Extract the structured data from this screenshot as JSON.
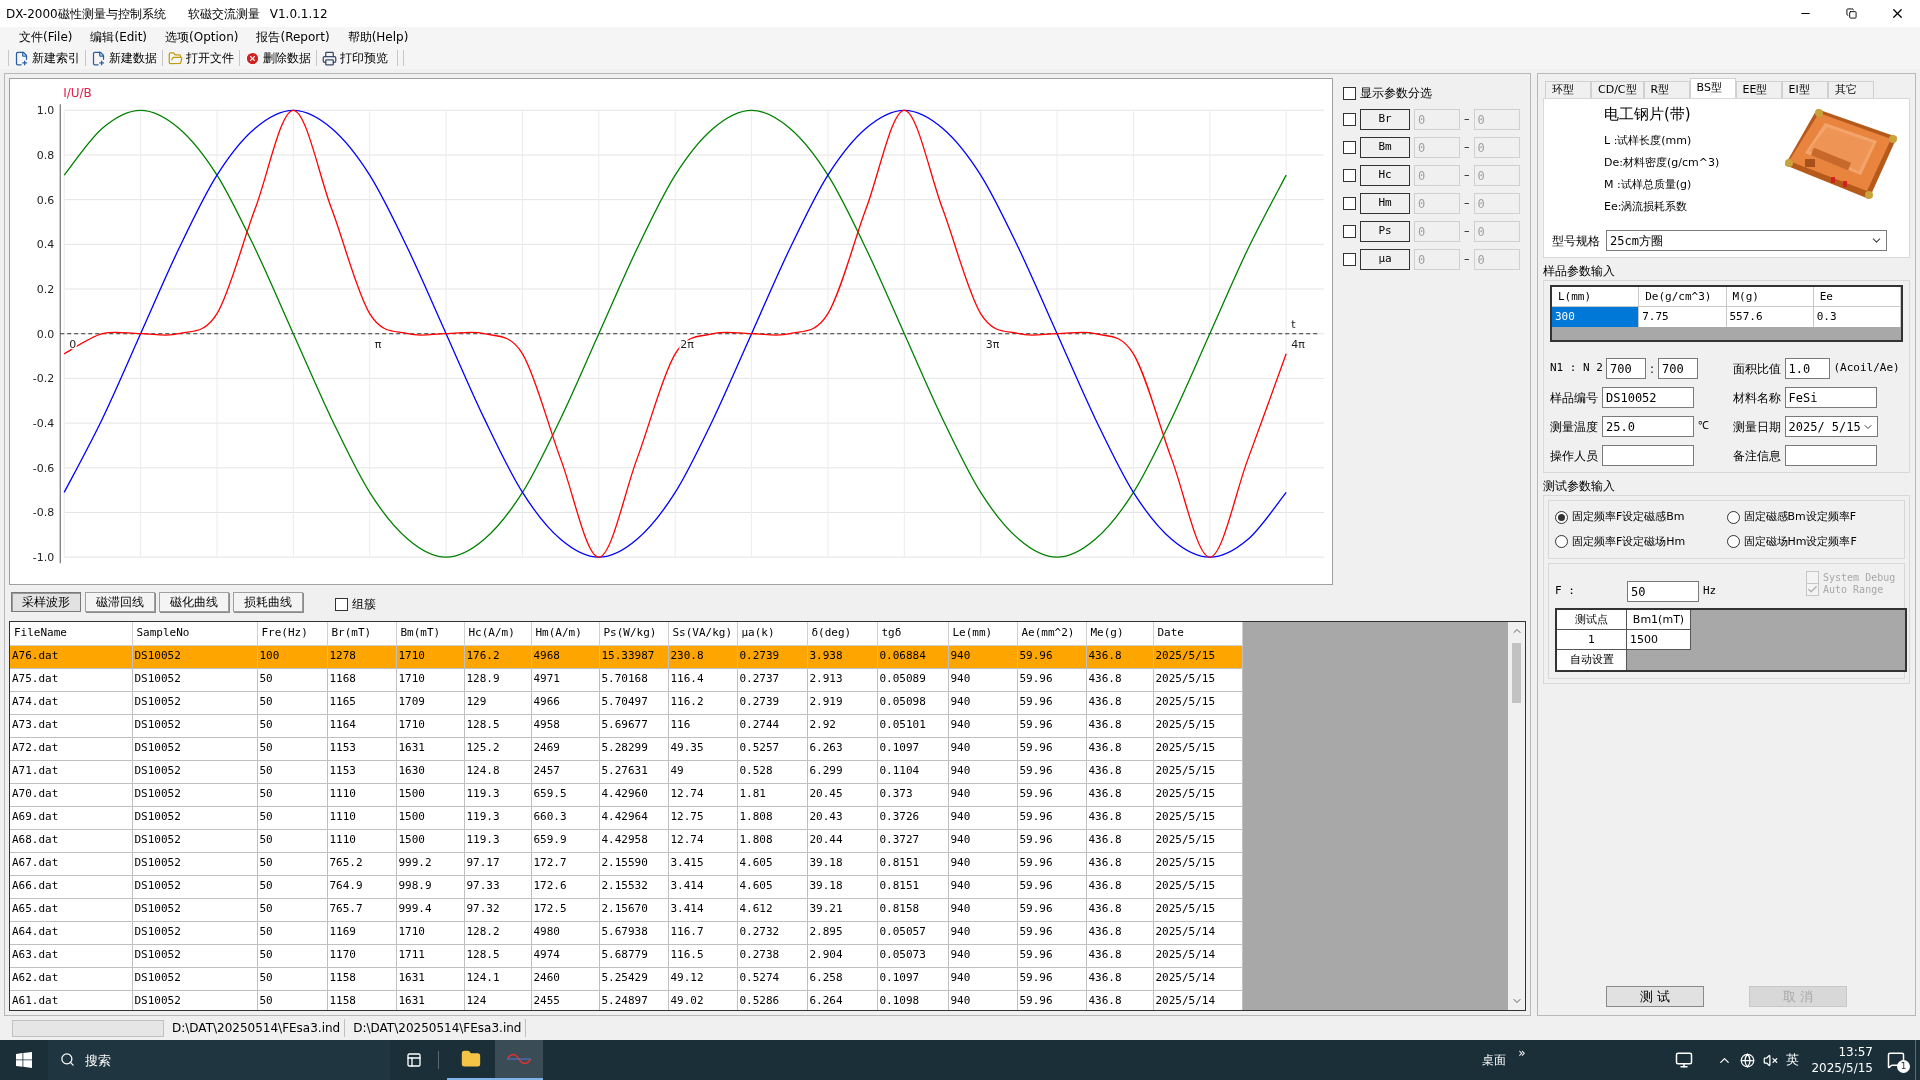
{
  "window": {
    "title": "DX-2000磁性测量与控制系统",
    "subtitle": "软磁交流测量",
    "version": "V1.0.1.12"
  },
  "menu": [
    "文件(File)",
    "编辑(Edit)",
    "选项(Option)",
    "报告(Report)",
    "帮助(Help)"
  ],
  "toolbar": [
    {
      "label": "新建索引",
      "kind": "new"
    },
    {
      "label": "新建数据",
      "kind": "new"
    },
    {
      "label": "打开文件",
      "kind": "open"
    },
    {
      "label": "删除数据",
      "kind": "delete"
    },
    {
      "label": "打印预览",
      "kind": "print"
    }
  ],
  "chart": {
    "chart_data": {
      "type": "line",
      "ylabel": "I/U/B",
      "xlabel": "t",
      "ylim": [
        -1.12,
        1.14
      ],
      "grid": true,
      "ref_lines": [
        {
          "axis": "y",
          "value": 0
        }
      ],
      "categories": [
        "0",
        null,
        null,
        null,
        null,
        null,
        null,
        null,
        "π",
        null,
        null,
        null,
        null,
        null,
        null,
        null,
        "2π",
        null,
        null,
        null,
        null,
        null,
        null,
        null,
        "3π",
        null,
        null,
        null,
        null,
        null,
        null,
        null,
        "4π"
      ],
      "yticks": [
        {
          "value": 1,
          "label": "1.0"
        },
        {
          "value": 0.8,
          "label": "0.8"
        },
        {
          "value": 0.6,
          "label": "0.6"
        },
        {
          "value": 0.4,
          "label": "0.4"
        },
        {
          "value": 0.2,
          "label": "0.2"
        },
        {
          "value": 0,
          "label": "0.0"
        },
        {
          "value": -0.2,
          "label": "-0.2"
        },
        {
          "value": -0.4,
          "label": "-0.4"
        },
        {
          "value": -0.6,
          "label": "-0.6"
        },
        {
          "value": -0.8,
          "label": "-0.8"
        },
        {
          "value": -1,
          "label": "-1.0"
        }
      ],
      "series": [
        {
          "color": "#008000",
          "values": [
            0.71,
            0.92,
            1,
            0.92,
            0.71,
            0.38,
            0,
            -0.38,
            -0.71,
            -0.92,
            -1,
            -0.92,
            -0.71,
            -0.38,
            0,
            0.38,
            0.71,
            0.92,
            1,
            0.92,
            0.71,
            0.38,
            0,
            -0.38,
            -0.71,
            -0.92,
            -1,
            -0.92,
            -0.71,
            -0.38,
            0,
            0.38,
            0.71
          ]
        },
        {
          "color": "#0000ff",
          "values": [
            -0.71,
            -0.38,
            0,
            0.38,
            0.71,
            0.92,
            1,
            0.92,
            0.71,
            0.38,
            0,
            -0.38,
            -0.71,
            -0.92,
            -1,
            -0.92,
            -0.71,
            -0.38,
            0,
            0.38,
            0.71,
            0.92,
            1,
            0.92,
            0.71,
            0.38,
            0,
            -0.38,
            -0.71,
            -0.92,
            -1,
            -0.92,
            -0.71
          ]
        },
        {
          "color": "#ff0000",
          "values": [
            -0.09,
            0,
            0,
            0,
            0.09,
            0.56,
            1,
            0.56,
            0.09,
            0,
            0,
            0,
            -0.09,
            -0.56,
            -1,
            -0.56,
            -0.09,
            0,
            0,
            0,
            0.09,
            0.56,
            1,
            0.56,
            0.09,
            0,
            0,
            0,
            -0.09,
            -0.56,
            -1,
            -0.56,
            -0.09
          ]
        }
      ]
    }
  },
  "filter": {
    "show": {
      "label": "显示参数分选",
      "checked": false
    },
    "rows": [
      {
        "label": "Br",
        "checked": false,
        "min": "0",
        "separator": "–",
        "max": "0",
        "disabled": true
      },
      {
        "label": "Bm",
        "checked": false,
        "min": "0",
        "separator": "–",
        "max": "0",
        "disabled": true
      },
      {
        "label": "Hc",
        "checked": false,
        "min": "0",
        "separator": "–",
        "max": "0",
        "disabled": true
      },
      {
        "label": "Hm",
        "checked": false,
        "min": "0",
        "separator": "–",
        "max": "0",
        "disabled": true
      },
      {
        "label": "Ps",
        "checked": false,
        "min": "0",
        "separator": "–",
        "max": "0",
        "disabled": true
      },
      {
        "label": "μa",
        "checked": false,
        "min": "0",
        "separator": "–",
        "max": "0",
        "disabled": true
      }
    ]
  },
  "view_tabs": [
    {
      "label": "采样波形",
      "selected": true
    },
    {
      "label": "磁滞回线",
      "selected": false
    },
    {
      "label": "磁化曲线",
      "selected": false
    },
    {
      "label": "损耗曲线",
      "selected": false
    }
  ],
  "cluster": {
    "label": "组簇",
    "checked": false
  },
  "table": {
    "columns": [
      "FileName",
      "SampleNo",
      "Fre(Hz)",
      "Br(mT)",
      "Bm(mT)",
      "Hc(A/m)",
      "Hm(A/m)",
      "Ps(W/kg)",
      "Ss(VA/kg)",
      "μa(k)",
      "δ(deg)",
      "tgδ",
      "Le(mm)",
      "Ae(mm^2)",
      "Me(g)",
      "Date"
    ],
    "rows": [
      {
        "selected": true,
        "cells": [
          "A76.dat",
          "DS10052",
          "100",
          "1278",
          "1710",
          "176.2",
          "4968",
          "15.33987",
          "230.8",
          "0.2739",
          "3.938",
          "0.06884",
          "940",
          "59.96",
          "436.8",
          "2025/5/15"
        ]
      },
      {
        "selected": false,
        "cells": [
          "A75.dat",
          "DS10052",
          "50",
          "1168",
          "1710",
          "128.9",
          "4971",
          "5.70168",
          "116.4",
          "0.2737",
          "2.913",
          "0.05089",
          "940",
          "59.96",
          "436.8",
          "2025/5/15"
        ]
      },
      {
        "selected": false,
        "cells": [
          "A74.dat",
          "DS10052",
          "50",
          "1165",
          "1709",
          "129",
          "4966",
          "5.70497",
          "116.2",
          "0.2739",
          "2.919",
          "0.05098",
          "940",
          "59.96",
          "436.8",
          "2025/5/15"
        ]
      },
      {
        "selected": false,
        "cells": [
          "A73.dat",
          "DS10052",
          "50",
          "1164",
          "1710",
          "128.5",
          "4958",
          "5.69677",
          "116",
          "0.2744",
          "2.92",
          "0.05101",
          "940",
          "59.96",
          "436.8",
          "2025/5/15"
        ]
      },
      {
        "selected": false,
        "cells": [
          "A72.dat",
          "DS10052",
          "50",
          "1153",
          "1631",
          "125.2",
          "2469",
          "5.28299",
          "49.35",
          "0.5257",
          "6.263",
          "0.1097",
          "940",
          "59.96",
          "436.8",
          "2025/5/15"
        ]
      },
      {
        "selected": false,
        "cells": [
          "A71.dat",
          "DS10052",
          "50",
          "1153",
          "1630",
          "124.8",
          "2457",
          "5.27631",
          "49",
          "0.528",
          "6.299",
          "0.1104",
          "940",
          "59.96",
          "436.8",
          "2025/5/15"
        ]
      },
      {
        "selected": false,
        "cells": [
          "A70.dat",
          "DS10052",
          "50",
          "1110",
          "1500",
          "119.3",
          "659.5",
          "4.42960",
          "12.74",
          "1.81",
          "20.45",
          "0.373",
          "940",
          "59.96",
          "436.8",
          "2025/5/15"
        ]
      },
      {
        "selected": false,
        "cells": [
          "A69.dat",
          "DS10052",
          "50",
          "1110",
          "1500",
          "119.3",
          "660.3",
          "4.42964",
          "12.75",
          "1.808",
          "20.43",
          "0.3726",
          "940",
          "59.96",
          "436.8",
          "2025/5/15"
        ]
      },
      {
        "selected": false,
        "cells": [
          "A68.dat",
          "DS10052",
          "50",
          "1110",
          "1500",
          "119.3",
          "659.9",
          "4.42958",
          "12.74",
          "1.808",
          "20.44",
          "0.3727",
          "940",
          "59.96",
          "436.8",
          "2025/5/15"
        ]
      },
      {
        "selected": false,
        "cells": [
          "A67.dat",
          "DS10052",
          "50",
          "765.2",
          "999.2",
          "97.17",
          "172.7",
          "2.15590",
          "3.415",
          "4.605",
          "39.18",
          "0.8151",
          "940",
          "59.96",
          "436.8",
          "2025/5/15"
        ]
      },
      {
        "selected": false,
        "cells": [
          "A66.dat",
          "DS10052",
          "50",
          "764.9",
          "998.9",
          "97.33",
          "172.6",
          "2.15532",
          "3.414",
          "4.605",
          "39.18",
          "0.8151",
          "940",
          "59.96",
          "436.8",
          "2025/5/15"
        ]
      },
      {
        "selected": false,
        "cells": [
          "A65.dat",
          "DS10052",
          "50",
          "765.7",
          "999.4",
          "97.32",
          "172.5",
          "2.15670",
          "3.414",
          "4.612",
          "39.21",
          "0.8158",
          "940",
          "59.96",
          "436.8",
          "2025/5/15"
        ]
      },
      {
        "selected": false,
        "cells": [
          "A64.dat",
          "DS10052",
          "50",
          "1169",
          "1710",
          "128.2",
          "4980",
          "5.67938",
          "116.7",
          "0.2732",
          "2.895",
          "0.05057",
          "940",
          "59.96",
          "436.8",
          "2025/5/14"
        ]
      },
      {
        "selected": false,
        "cells": [
          "A63.dat",
          "DS10052",
          "50",
          "1170",
          "1711",
          "128.5",
          "4974",
          "5.68779",
          "116.5",
          "0.2738",
          "2.904",
          "0.05073",
          "940",
          "59.96",
          "436.8",
          "2025/5/14"
        ]
      },
      {
        "selected": false,
        "cells": [
          "A62.dat",
          "DS10052",
          "50",
          "1158",
          "1631",
          "124.1",
          "2460",
          "5.25429",
          "49.12",
          "0.5274",
          "6.258",
          "0.1097",
          "940",
          "59.96",
          "436.8",
          "2025/5/14"
        ]
      },
      {
        "selected": false,
        "cells": [
          "A61.dat",
          "DS10052",
          "50",
          "1158",
          "1631",
          "124",
          "2455",
          "5.24897",
          "49.02",
          "0.5286",
          "6.264",
          "0.1098",
          "940",
          "59.96",
          "436.8",
          "2025/5/14"
        ]
      }
    ]
  },
  "status_bar": {
    "paths": [
      "D:\\DAT\\20250514\\FEsa3.ind",
      "D:\\DAT\\20250514\\FEsa3.ind"
    ]
  },
  "type_tabs": [
    {
      "label": "环型",
      "selected": false
    },
    {
      "label": "CD/C型",
      "selected": false
    },
    {
      "label": "R型",
      "selected": false
    },
    {
      "label": "BS型",
      "selected": true
    },
    {
      "label": "EE型",
      "selected": false
    },
    {
      "label": "EI型",
      "selected": false
    },
    {
      "label": "其它",
      "selected": false
    }
  ],
  "sample_type": {
    "title": "电工钢片(带)",
    "legend": [
      "L :试样长度(mm)",
      "De:材料密度(g/cm^3)",
      "M :试样总质量(g)",
      "Ee:涡流损耗系数"
    ]
  },
  "model": {
    "label": "型号规格",
    "value": "25cm方圈"
  },
  "sample_params": {
    "title": "样品参数输入",
    "columns": [
      "L(mm)",
      "De(g/cm^3)",
      "M(g)",
      "Ee"
    ],
    "cells": [
      {
        "value": "300",
        "selected": true
      },
      {
        "value": "7.75",
        "selected": false
      },
      {
        "value": "557.6",
        "selected": false
      },
      {
        "value": "0.3",
        "selected": false
      }
    ]
  },
  "form": [
    {
      "kind": "turns",
      "label": "N1 : N 2",
      "values": [
        "700",
        "700"
      ],
      "separator": ":"
    },
    {
      "kind": "text",
      "label": "面积比值",
      "value": "1.0",
      "unit": "(Acoil/Ae)"
    },
    {
      "kind": "text",
      "label": "样品编号",
      "value": "DS10052"
    },
    {
      "kind": "text",
      "label": "材料名称",
      "value": "FeSi"
    },
    {
      "kind": "text",
      "label": "测量温度",
      "value": "25.0",
      "unit": "℃"
    },
    {
      "kind": "date",
      "label": "测量日期",
      "value": "2025/ 5/15"
    },
    {
      "kind": "text",
      "label": "操作人员"
    },
    {
      "kind": "text",
      "label": "备注信息"
    }
  ],
  "test_params": {
    "title": "测试参数输入",
    "modes": [
      {
        "label": "固定频率F设定磁感Bm",
        "selected": true
      },
      {
        "label": "固定磁感Bm设定频率F",
        "selected": false
      },
      {
        "label": "固定频率F设定磁场Hm",
        "selected": false
      },
      {
        "label": "固定磁场Hm设定频率F",
        "selected": false
      }
    ],
    "options": [
      {
        "label": "System Debug",
        "checked": false,
        "disabled": true
      },
      {
        "label": "Auto Range",
        "checked": true,
        "disabled": true
      }
    ],
    "frequency": {
      "label": "F :",
      "value": "50",
      "unit": "Hz"
    },
    "points": {
      "columns": [
        "测试点",
        "Bm1(mT)"
      ],
      "rows": [
        [
          "1",
          "1500"
        ]
      ],
      "auto": "自动设置"
    }
  },
  "actions": [
    {
      "label": "测 试",
      "disabled": false
    },
    {
      "label": "取 消",
      "disabled": true
    }
  ],
  "taskbar": {
    "search": {
      "placeholder": "搜索"
    },
    "desktop": "桌面",
    "chevron": "»",
    "ime": "英",
    "time": "13:57",
    "date": "2025/5/15",
    "notifications": "1"
  }
}
